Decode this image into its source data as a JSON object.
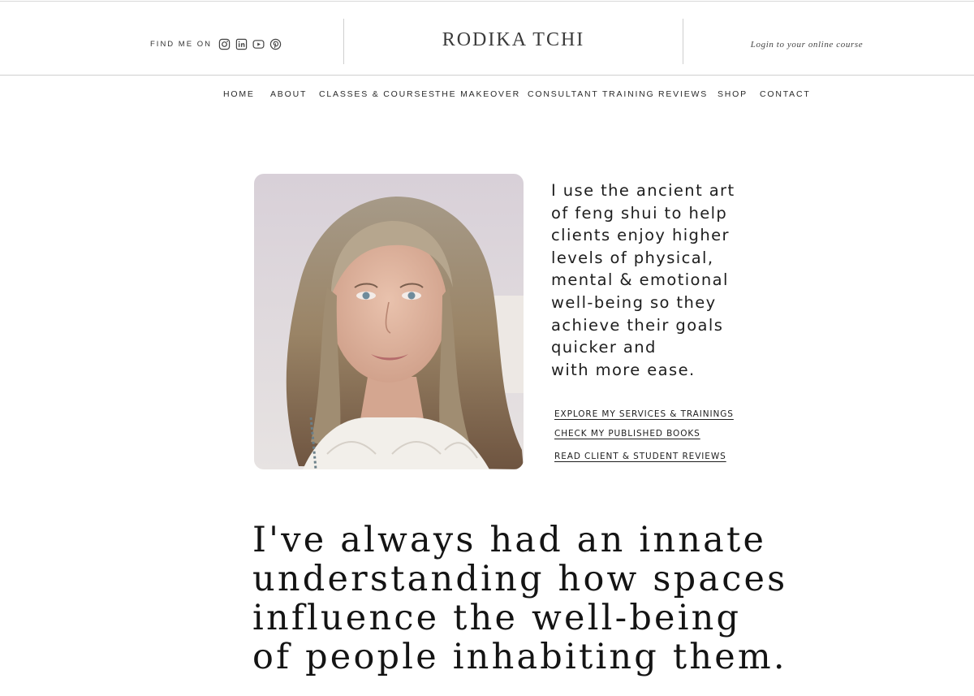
{
  "header": {
    "find_me_label": "FIND ME ON",
    "social_icons": [
      "instagram-icon",
      "linkedin-icon",
      "youtube-icon",
      "pinterest-icon"
    ],
    "brand": "RODIKA TCHI",
    "login_link": "Login to your online course"
  },
  "nav": {
    "items": [
      {
        "label": "HOME"
      },
      {
        "label": "ABOUT"
      },
      {
        "label": "CLASSES & COURSES"
      },
      {
        "label": "THE MAKEOVER"
      },
      {
        "label": "CONSULTANT TRAINING"
      },
      {
        "label": "REVIEWS"
      },
      {
        "label": "SHOP"
      },
      {
        "label": "CONTACT"
      }
    ]
  },
  "hero": {
    "intro_lines": [
      "I use the ancient art",
      "of feng shui to help",
      "clients enjoy higher",
      "levels of physical,",
      "mental & emotional",
      "well-being so they",
      "achieve their goals",
      "quicker and",
      "with more ease."
    ],
    "links": [
      {
        "label": "EXPLORE MY SERVICES & TRAININGS"
      },
      {
        "label": "CHECK MY PUBLISHED BOOKS"
      },
      {
        "label": "READ CLIENT & STUDENT REVIEWS"
      }
    ]
  },
  "statement": {
    "lines": [
      "I've always had an innate",
      "understanding how spaces",
      "influence the well-being",
      "of people inhabiting them."
    ]
  },
  "colors": {
    "text": "#1e1e1e",
    "divider": "#cfcfcf",
    "background": "#ffffff"
  }
}
